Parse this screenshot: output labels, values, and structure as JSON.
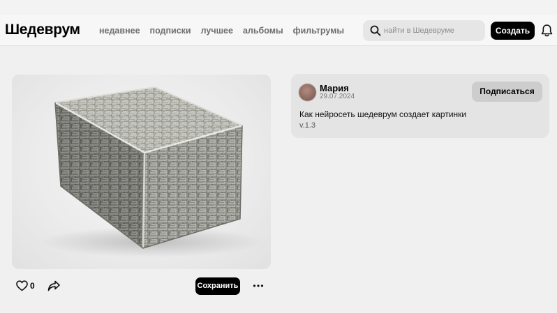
{
  "header": {
    "logo": "Шедеврум",
    "nav": [
      "недавнее",
      "подписки",
      "лучшее",
      "альбомы",
      "фильтрумы"
    ],
    "search_placeholder": "найти в Шедевруме",
    "create_label": "Создать"
  },
  "post": {
    "image_alt": "ornate carved metallic box",
    "likes": "0",
    "save_label": "Сохранить"
  },
  "author": {
    "name": "Мария",
    "date": "29.07.2024",
    "subscribe_label": "Подписаться",
    "prompt": "Как нейросеть шедеврум создает картинки",
    "version": "v.1.3"
  },
  "icons": {
    "search": "search-icon",
    "bell": "bell-icon",
    "like": "heart-icon",
    "share": "share-icon",
    "more": "more-dots-icon"
  },
  "colors": {
    "background": "#f0f0f0",
    "header": "#f7f7f7",
    "button_dark": "#000000",
    "card": "#e4e4e4",
    "subscribe_button": "#cdcdcd",
    "nav_text": "#6e6e6e"
  }
}
